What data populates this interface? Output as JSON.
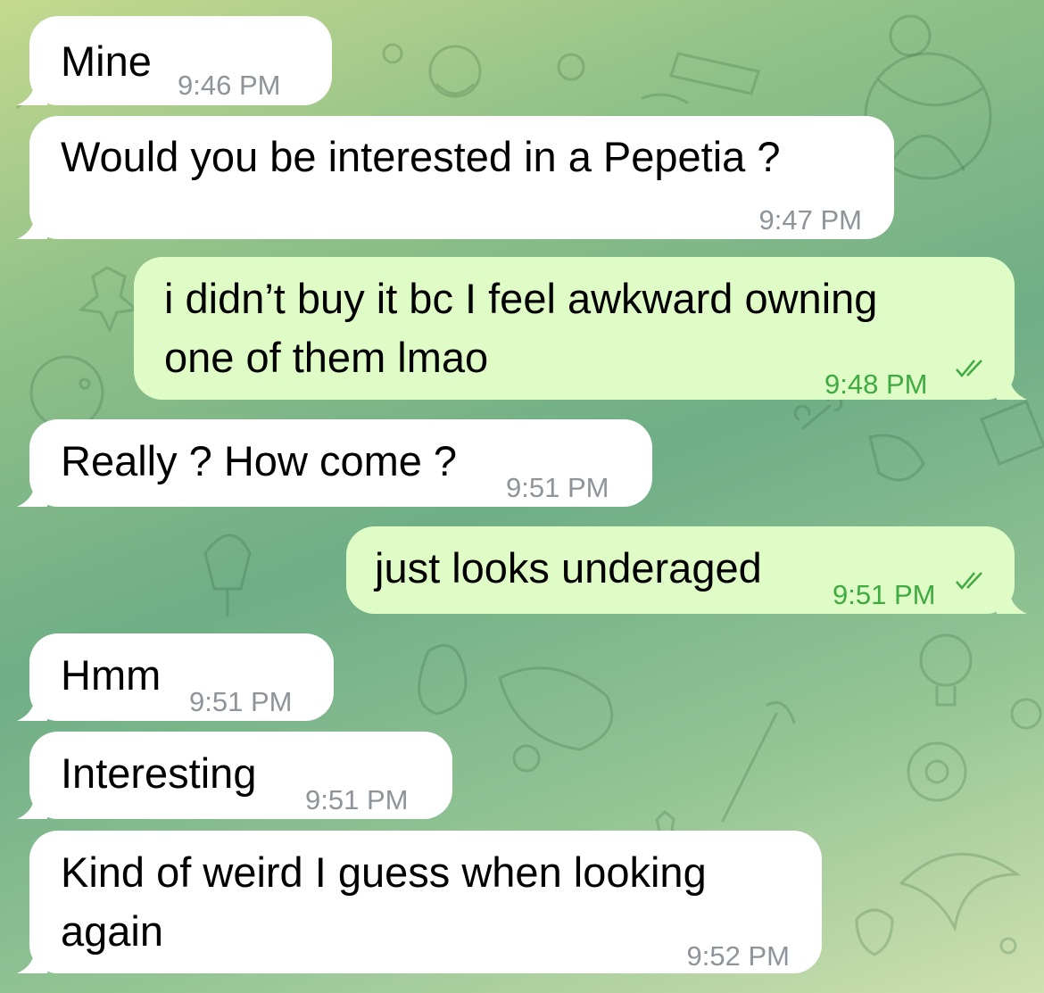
{
  "chat": {
    "messages": [
      {
        "dir": "in",
        "text": "Mine",
        "time": "9:46 PM"
      },
      {
        "dir": "in",
        "text": "Would you be interested in a Pepetia ?",
        "time": "9:47 PM"
      },
      {
        "dir": "out",
        "lines": [
          "i didn’t buy it bc I feel awkward owning",
          "one of them lmao"
        ],
        "time": "9:48 PM",
        "status_icon": "double-check-icon"
      },
      {
        "dir": "in",
        "text": "Really ? How come ?",
        "time": "9:51 PM"
      },
      {
        "dir": "out",
        "text": "just looks underaged",
        "time": "9:51 PM",
        "status_icon": "double-check-icon"
      },
      {
        "dir": "in",
        "text": "Hmm",
        "time": "9:51 PM"
      },
      {
        "dir": "in",
        "text": "Interesting",
        "time": "9:51 PM"
      },
      {
        "dir": "in",
        "lines": [
          "Kind of weird I guess when looking",
          "again"
        ],
        "time": "9:52 PM"
      }
    ]
  },
  "colors": {
    "incoming_bubble": "#ffffff",
    "outgoing_bubble": "#e0fcc6",
    "outgoing_time": "#3faa41",
    "incoming_time": "#8e9499"
  }
}
